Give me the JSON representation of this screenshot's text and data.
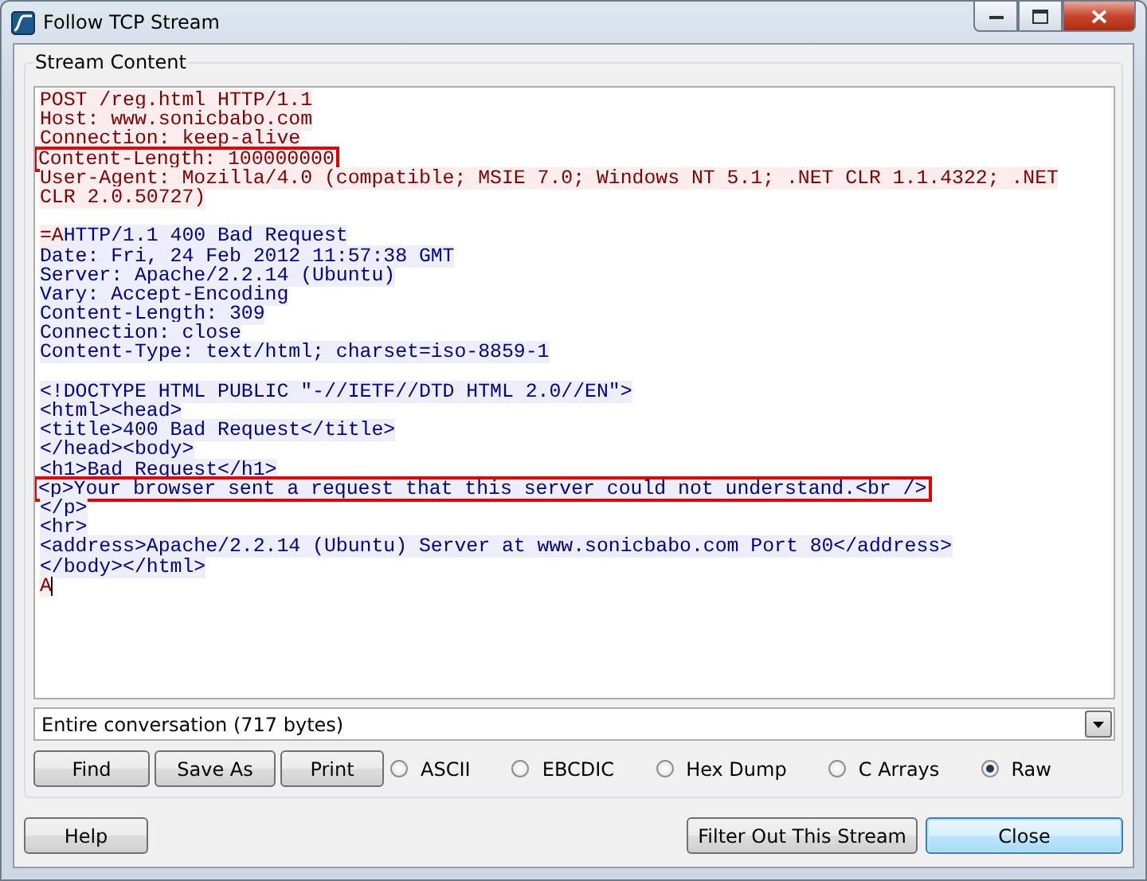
{
  "window": {
    "title": "Follow TCP Stream"
  },
  "group_title": "Stream Content",
  "stream_lines": [
    {
      "kind": "text",
      "boxed": false,
      "segments": [
        {
          "kind": "client",
          "text": "POST /reg.html HTTP/1.1"
        }
      ]
    },
    {
      "kind": "text",
      "boxed": false,
      "segments": [
        {
          "kind": "client",
          "text": "Host: www.sonicbabo.com"
        }
      ]
    },
    {
      "kind": "text",
      "boxed": false,
      "segments": [
        {
          "kind": "client",
          "text": "Connection: keep-alive"
        }
      ]
    },
    {
      "kind": "text",
      "boxed": true,
      "segments": [
        {
          "kind": "client",
          "text": "Content-Length: 100000000"
        }
      ]
    },
    {
      "kind": "text",
      "boxed": false,
      "segments": [
        {
          "kind": "client",
          "text": "User-Agent: Mozilla/4.0 (compatible; MSIE 7.0; Windows NT 5.1; .NET CLR 1.1.4322; .NET"
        }
      ]
    },
    {
      "kind": "text",
      "boxed": false,
      "segments": [
        {
          "kind": "client",
          "text": "CLR 2.0.50727)"
        }
      ]
    },
    {
      "kind": "blank"
    },
    {
      "kind": "text",
      "boxed": false,
      "segments": [
        {
          "kind": "client",
          "text": "=A"
        },
        {
          "kind": "server",
          "text": "HTTP/1.1 400 Bad Request"
        }
      ]
    },
    {
      "kind": "text",
      "boxed": false,
      "segments": [
        {
          "kind": "server",
          "text": "Date: Fri, 24 Feb 2012 11:57:38 GMT"
        }
      ]
    },
    {
      "kind": "text",
      "boxed": false,
      "segments": [
        {
          "kind": "server",
          "text": "Server: Apache/2.2.14 (Ubuntu)"
        }
      ]
    },
    {
      "kind": "text",
      "boxed": false,
      "segments": [
        {
          "kind": "server",
          "text": "Vary: Accept-Encoding"
        }
      ]
    },
    {
      "kind": "text",
      "boxed": false,
      "segments": [
        {
          "kind": "server",
          "text": "Content-Length: 309"
        }
      ]
    },
    {
      "kind": "text",
      "boxed": false,
      "segments": [
        {
          "kind": "server",
          "text": "Connection: close"
        }
      ]
    },
    {
      "kind": "text",
      "boxed": false,
      "segments": [
        {
          "kind": "server",
          "text": "Content-Type: text/html; charset=iso-8859-1"
        }
      ]
    },
    {
      "kind": "blank"
    },
    {
      "kind": "text",
      "boxed": false,
      "segments": [
        {
          "kind": "server",
          "text": "<!DOCTYPE HTML PUBLIC \"-//IETF//DTD HTML 2.0//EN\">"
        }
      ]
    },
    {
      "kind": "text",
      "boxed": false,
      "segments": [
        {
          "kind": "server",
          "text": "<html><head>"
        }
      ]
    },
    {
      "kind": "text",
      "boxed": false,
      "segments": [
        {
          "kind": "server",
          "text": "<title>400 Bad Request</title>"
        }
      ]
    },
    {
      "kind": "text",
      "boxed": false,
      "segments": [
        {
          "kind": "server",
          "text": "</head><body>"
        }
      ]
    },
    {
      "kind": "text",
      "boxed": false,
      "segments": [
        {
          "kind": "server",
          "text": "<h1>Bad Request</h1>"
        }
      ]
    },
    {
      "kind": "text",
      "boxed": true,
      "segments": [
        {
          "kind": "server",
          "text": "<p>Your browser sent a request that this server could not understand.<br />"
        }
      ]
    },
    {
      "kind": "text",
      "boxed": false,
      "segments": [
        {
          "kind": "server",
          "text": "</p>"
        }
      ]
    },
    {
      "kind": "text",
      "boxed": false,
      "segments": [
        {
          "kind": "server",
          "text": "<hr>"
        }
      ]
    },
    {
      "kind": "text",
      "boxed": false,
      "segments": [
        {
          "kind": "server",
          "text": "<address>Apache/2.2.14 (Ubuntu) Server at www.sonicbabo.com Port 80</address>"
        }
      ]
    },
    {
      "kind": "text",
      "boxed": false,
      "segments": [
        {
          "kind": "server",
          "text": "</body></html>"
        }
      ]
    },
    {
      "kind": "text",
      "boxed": false,
      "segments": [
        {
          "kind": "client",
          "text": "A"
        }
      ]
    }
  ],
  "conversation_select": {
    "value": "Entire conversation (717 bytes)"
  },
  "action_buttons": [
    {
      "label": "Find"
    },
    {
      "label": "Save As"
    },
    {
      "label": "Print"
    }
  ],
  "format_options": [
    {
      "label": "ASCII",
      "selected": false
    },
    {
      "label": "EBCDIC",
      "selected": false
    },
    {
      "label": "Hex Dump",
      "selected": false
    },
    {
      "label": "C Arrays",
      "selected": false
    },
    {
      "label": "Raw",
      "selected": true
    }
  ],
  "footer_buttons": [
    {
      "label": "Help",
      "kind": "plain"
    },
    {
      "label": "Filter Out This Stream",
      "kind": "plain"
    },
    {
      "label": "Close",
      "kind": "default"
    }
  ]
}
